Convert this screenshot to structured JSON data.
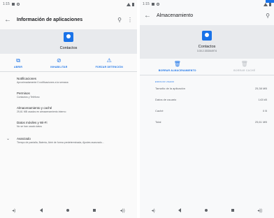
{
  "left": {
    "status": {
      "time": "1:15"
    },
    "appbar": {
      "back_icon": "arrow-back",
      "title": "Información de aplicaciones",
      "search_icon": "search",
      "more_icon": "more-vert"
    },
    "app": {
      "name": "Contactos",
      "icon": "contacts-icon",
      "icon_color": "#1a73e8"
    },
    "actions": [
      {
        "label": "ABRIR",
        "icon": "open-icon"
      },
      {
        "label": "INHABILITAR",
        "icon": "disable-icon"
      },
      {
        "label": "FORZAR DETENCIÓN",
        "icon": "warning-icon"
      }
    ],
    "items": [
      {
        "title": "Notificaciones",
        "subtitle": "Aproximadamente 0 notificaciones a la semana"
      },
      {
        "title": "Permisos",
        "subtitle": "Contactos y Teléfono"
      },
      {
        "title": "Almacenamiento y caché",
        "subtitle": "25,61 MB usados en almacenamiento interno"
      },
      {
        "title": "Datos móviles y Wi-Fi",
        "subtitle": "No se han usado datos"
      },
      {
        "title": "Avanzado",
        "subtitle": "Tiempo de pantalla, Batería, Abrir de forma predeterminada, Ajustes avanzado..."
      }
    ]
  },
  "right": {
    "status": {
      "time": "1:15"
    },
    "appbar": {
      "back_icon": "arrow-back",
      "title": "Almacenamiento",
      "search_icon": "search"
    },
    "app": {
      "name": "Contactos",
      "version": "3.30.2.333344974",
      "icon": "contacts-icon"
    },
    "actions": [
      {
        "label": "BORRAR ALMACENAMIENTO",
        "icon": "delete-icon",
        "enabled": true
      },
      {
        "label": "BORRAR CACHÉ",
        "icon": "delete-icon",
        "enabled": false
      }
    ],
    "section": "ESPACIO USADO",
    "rows": [
      {
        "label": "Tamaño de la aplicación",
        "value": "25,38 MB"
      },
      {
        "label": "Datos de usuario",
        "value": "143 kB"
      },
      {
        "label": "Caché",
        "value": "0 B"
      },
      {
        "label": "Total",
        "value": "25,61 MB"
      }
    ]
  },
  "colors": {
    "accent": "#1a73e8",
    "header_bg": "#e8eaed",
    "disabled": "#bdc1c6"
  }
}
